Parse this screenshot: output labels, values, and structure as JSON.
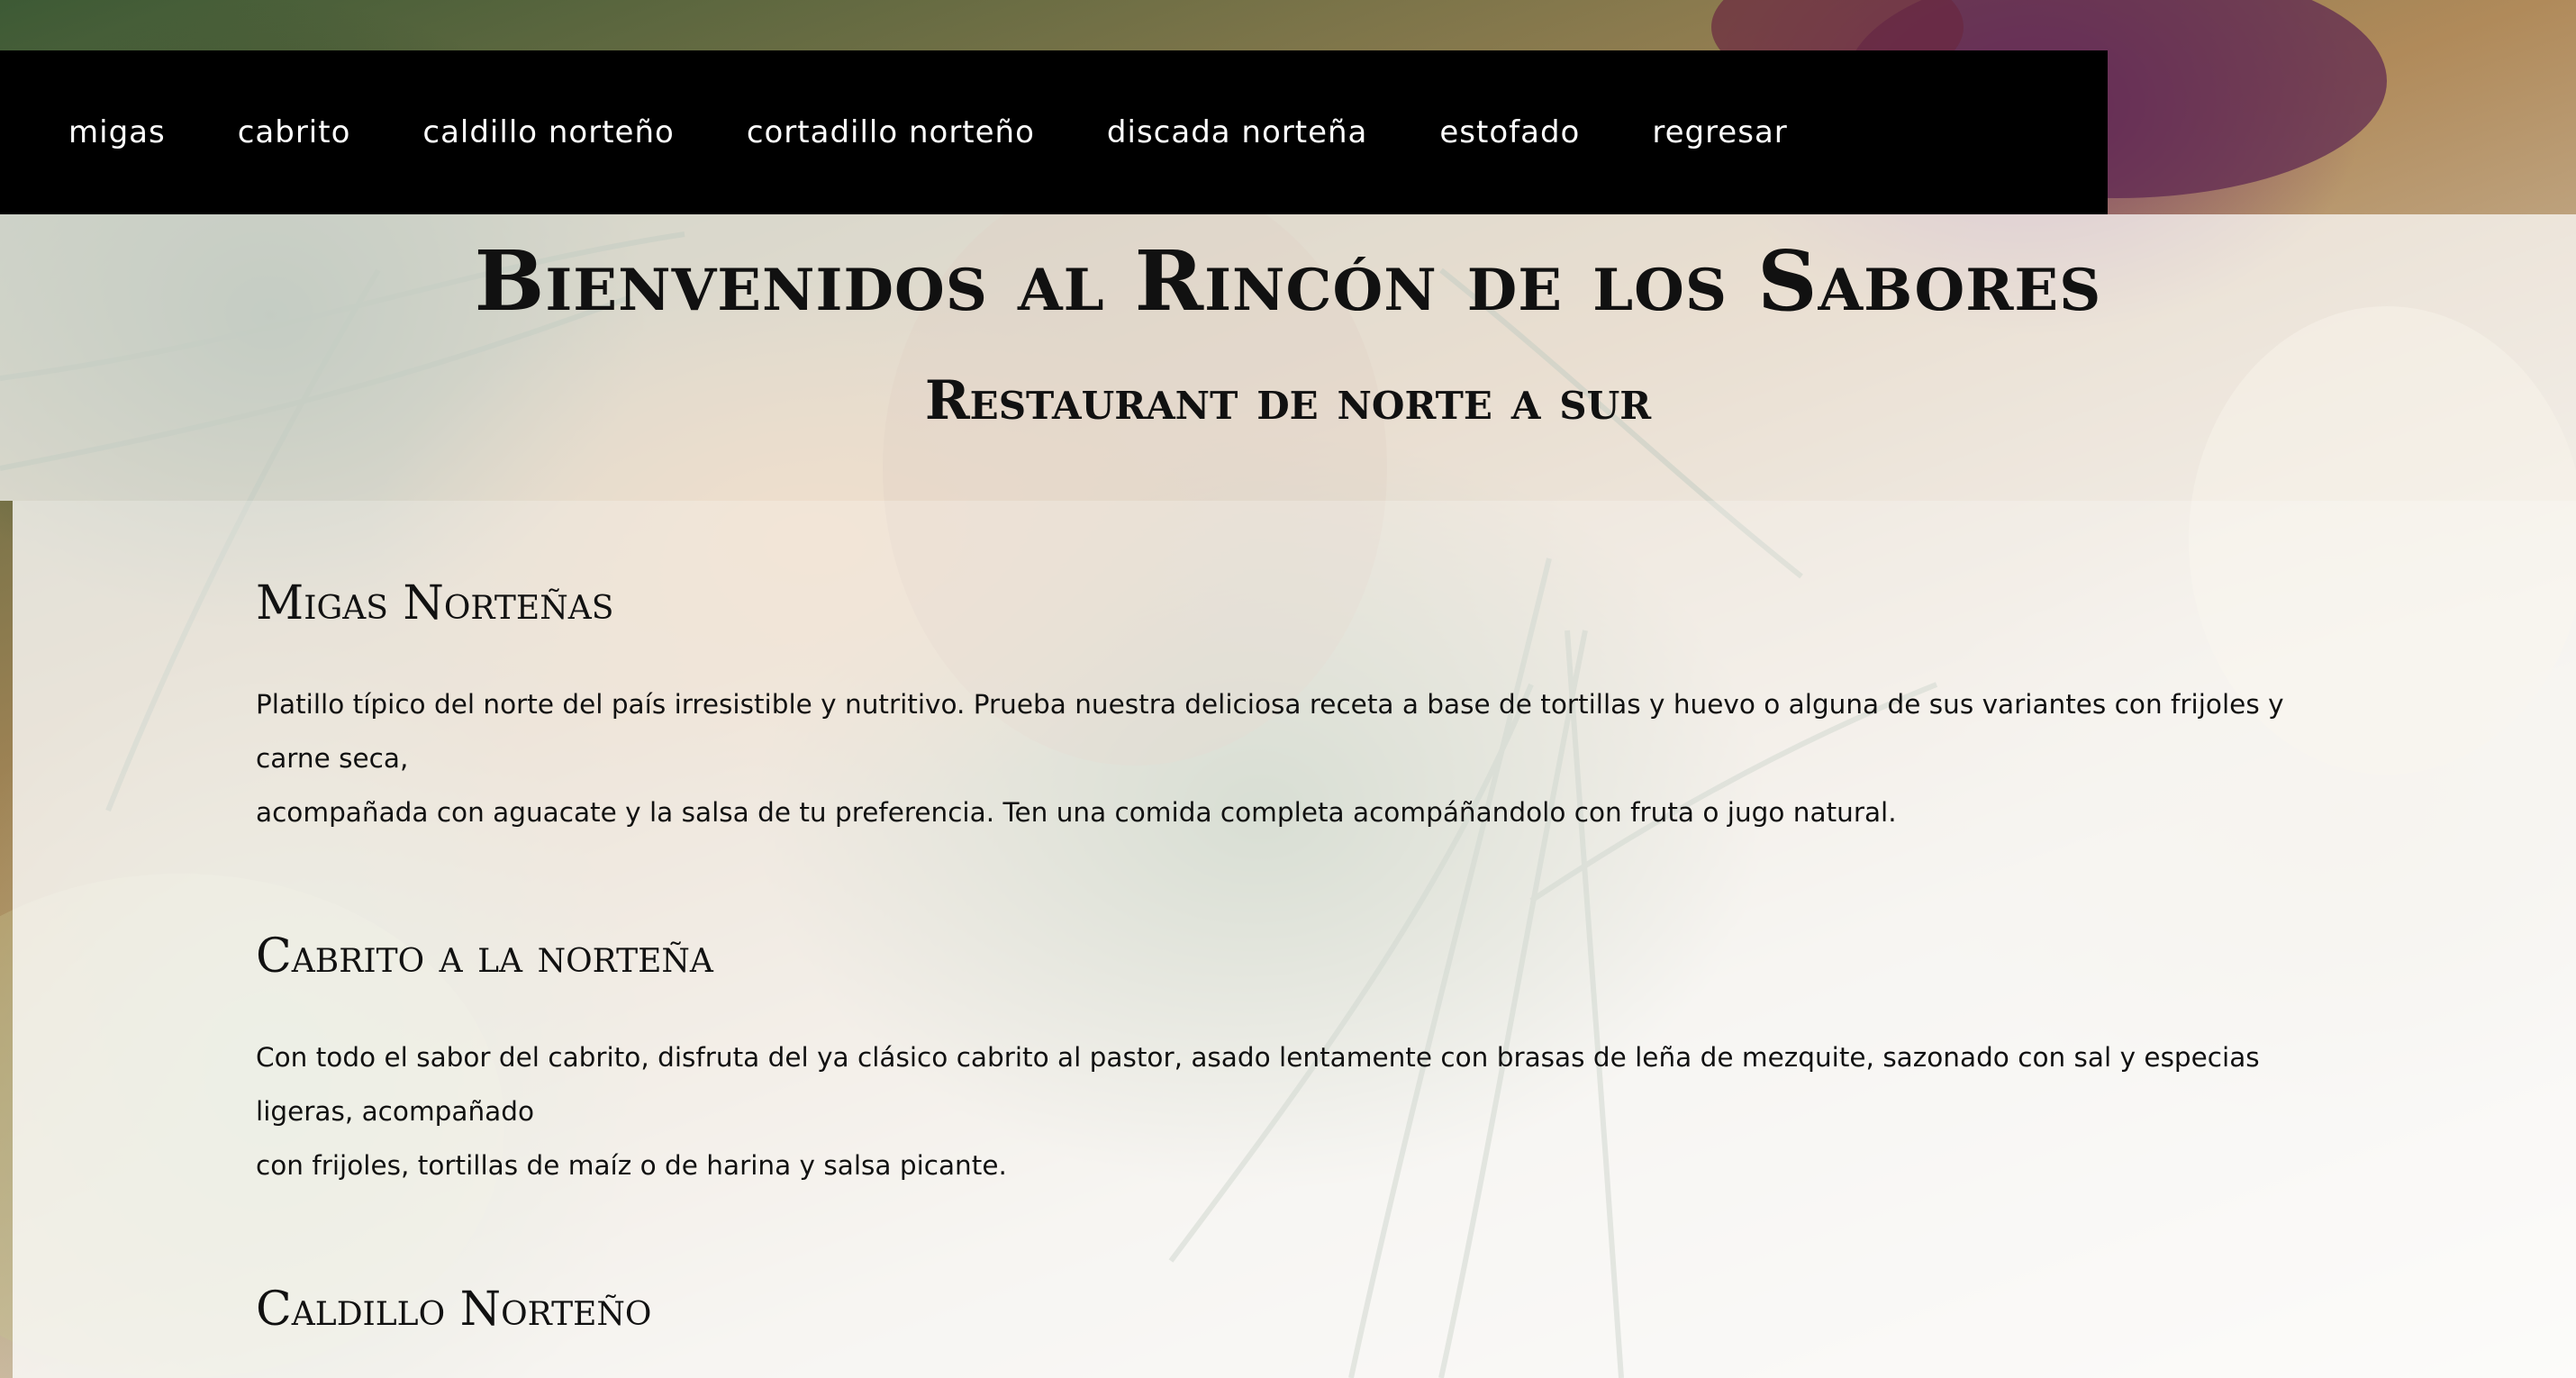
{
  "nav": {
    "items": [
      {
        "label": "Migas"
      },
      {
        "label": "Cabrito"
      },
      {
        "label": "Caldillo Norteño"
      },
      {
        "label": "Cortadillo Norteño"
      },
      {
        "label": "Discada Norteña"
      },
      {
        "label": "Estofado"
      },
      {
        "label": "Regresar"
      }
    ]
  },
  "header": {
    "title": "Bienvenidos al Rincón de los Sabores",
    "subtitle": "Restaurant de norte a sur"
  },
  "dishes": [
    {
      "title": "Migas Norteñas",
      "description_line1": "Platillo típico del norte del país irresistible y nutritivo. Prueba nuestra deliciosa receta a base de tortillas y huevo o alguna de sus variantes con frijoles y carne seca,",
      "description_line2": "acompañada con aguacate y la salsa de tu preferencia. Ten una comida completa acompáñandolo con fruta o jugo natural."
    },
    {
      "title": "Cabrito a la norteña",
      "description_line1": "Con todo el sabor del cabrito, disfruta del ya clásico cabrito al pastor, asado lentamente con brasas de leña de mezquite, sazonado con sal y especias ligeras, acompañado",
      "description_line2": "con frijoles, tortillas de maíz o de harina y salsa picante."
    },
    {
      "title": "Caldillo Norteño"
    }
  ]
}
